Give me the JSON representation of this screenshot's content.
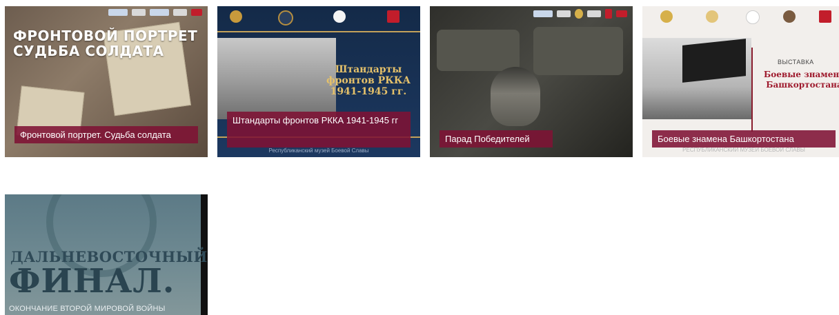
{
  "cards": [
    {
      "caption": "Фронтовой портрет. Судьба солдата",
      "image_title": "ФРОНТОВОЙ ПОРТРЕТ\nСУДЬБА СОЛДАТА"
    },
    {
      "caption": "Штандарты фронтов РККА 1941-1945 гг",
      "image_title": "Штандарты\nфронтов РККА\n1941-1945 гг.",
      "image_footer": "Республиканский музей Боевой Славы"
    },
    {
      "caption": "Парад Победителей"
    },
    {
      "caption": "Боевые знамена Башкортостана",
      "image_label": "ВЫСТАВКА",
      "image_title": "Боевые знамена\nБашкортостана",
      "image_footer": "РЕСПУБЛИКАНСКИЙ МУЗЕЙ БОЕВОЙ СЛАВЫ"
    },
    {
      "image_line1": "ДАЛЬНЕВОСТОЧНЫЙ",
      "image_line2": "ФИНАЛ.",
      "image_line3": "ОКОНЧАНИЕ ВТОРОЙ МИРОВОЙ ВОЙНЫ"
    }
  ],
  "colors": {
    "caption_bg": "#7e1234",
    "caption_text": "#ffffff"
  }
}
